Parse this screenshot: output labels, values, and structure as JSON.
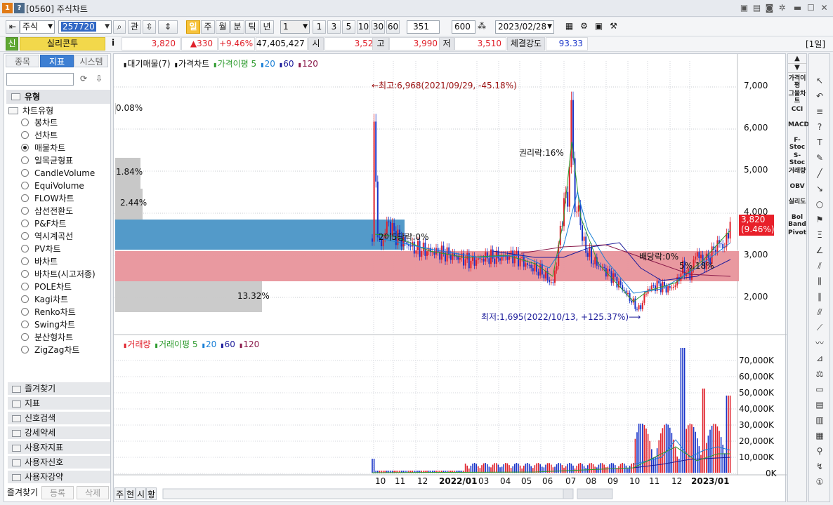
{
  "window": {
    "number": "1",
    "help": "?",
    "title": "[0560] 주식차트"
  },
  "toolbar": {
    "market": "주식",
    "code": "257720",
    "gwan_label": "관",
    "periods": [
      "일",
      "주",
      "월",
      "분",
      "틱",
      "년"
    ],
    "active_period": "일",
    "interval": "1",
    "quick_intervals": [
      "1",
      "3",
      "5",
      "10",
      "30",
      "60"
    ],
    "count": "351",
    "total": "600",
    "slash": "/",
    "date": "2023/02/28"
  },
  "quote": {
    "badge": "신",
    "name": "실리콘투",
    "info": "i",
    "price": "3,820",
    "change": "▲330",
    "rate": "+9.46%",
    "volume": "47,405,427",
    "open_label": "시",
    "open": "3,520",
    "high_label": "고",
    "high": "3,990",
    "low_label": "저",
    "low": "3,510",
    "strength_label": "체결강도",
    "strength": "93.33",
    "period_badge": "[1일]"
  },
  "left": {
    "tabs": [
      "종목",
      "지표",
      "시스템"
    ],
    "active_tab": "지표",
    "search_placeholder": "",
    "section": "유형",
    "group": "차트유형",
    "chart_types": [
      "봉차트",
      "선차트",
      "매물차트",
      "일목균형표",
      "CandleVolume",
      "EquiVolume",
      "FLOW차트",
      "삼선전환도",
      "P&F차트",
      "역시계곡선",
      "PV차트",
      "바차트",
      "바차트(시고저종)",
      "POLE차트",
      "Kagi차트",
      "Renko차트",
      "Swing차트",
      "분산형차트",
      "ZigZag차트"
    ],
    "selected_type": "매물차트",
    "folders": [
      "즐겨찾기",
      "지표",
      "신호검색",
      "강세약세",
      "사용자지표",
      "사용자신호",
      "사용자강약"
    ],
    "bottom_buttons": [
      "즐겨찾기",
      "등록",
      "삭제"
    ]
  },
  "chart": {
    "legend_main": [
      "대기매물(7)",
      "가격차트",
      "가격이평 5",
      "20",
      "60",
      "120"
    ],
    "legend_vol": [
      "거래량",
      "거래이평 5",
      "20",
      "60",
      "120"
    ],
    "colors": {
      "ma5": "#2e9b2e",
      "ma20": "#1a7fd6",
      "ma60": "#1b1b9a",
      "ma120": "#8a1a4a",
      "up": "#e0212b",
      "down": "#1b36c9",
      "current_bg": "#e8202a"
    },
    "price_axis": [
      "7,000",
      "6,000",
      "5,000",
      "4,000",
      "3,000",
      "2,000"
    ],
    "current_price": "3,820",
    "current_rate": "(9.46%)",
    "volume_axis": [
      "70,000K",
      "60,000K",
      "50,000K",
      "40,000K",
      "30,000K",
      "20,000K",
      "10,000K",
      "0K"
    ],
    "x_labels": [
      "10",
      "11",
      "12",
      "2022/01",
      "03",
      "04",
      "05",
      "06",
      "07",
      "08",
      "09",
      "10",
      "11",
      "12",
      "2023/01"
    ],
    "annotations": {
      "high": "←최고:6,968(2021/09/29, -45.18%)",
      "low": "최저:1,695(2022/10/13, +125.37%)⟶",
      "rights": "권리락:16%",
      "dividend": "배당락:0%",
      "rights2": "2이5당락:0%",
      "misc": "5%.18%"
    },
    "volume_profile": [
      {
        "label": "0.08%",
        "pct": 0.08
      },
      {
        "label": "1.84%",
        "pct": 1.84
      },
      {
        "label": "2.44%",
        "pct": 2.44
      },
      {
        "label": "",
        "pct": 28.5
      },
      {
        "label": "",
        "pct": 38.0
      },
      {
        "label": "13.32%",
        "pct": 13.32
      }
    ],
    "bottom_tabs": [
      "주",
      "현",
      "시",
      "황"
    ]
  },
  "right_indicators": [
    "가격이평",
    "그물차트",
    "CCI",
    "MACD",
    "F-Stoc",
    "S-Stoc",
    "거래량",
    "OBV",
    "실리도",
    "Bol Band",
    "Pivot"
  ]
}
